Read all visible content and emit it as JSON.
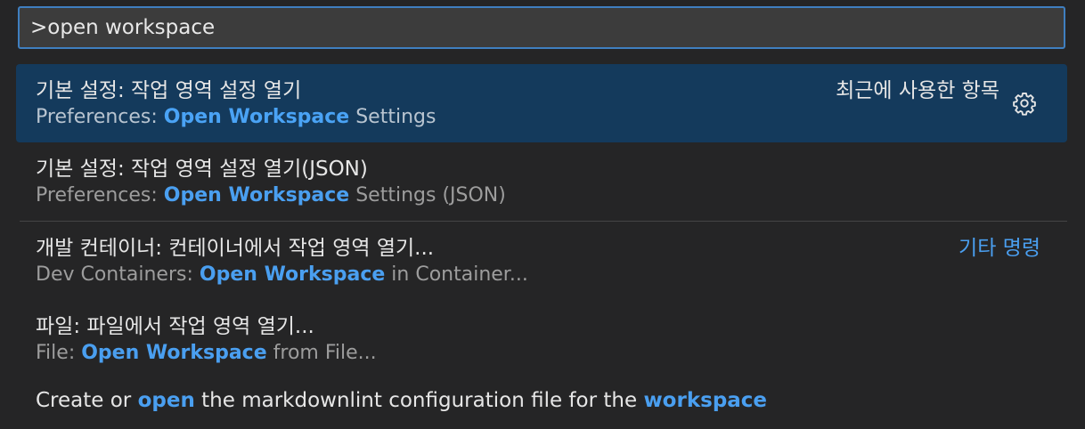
{
  "search": {
    "value": ">open workspace"
  },
  "items": [
    {
      "title": "기본 설정: 작업 영역 설정 열기",
      "subtitle_prefix": "Preferences: ",
      "subtitle_hl": "Open Workspace",
      "subtitle_suffix": " Settings",
      "right_label": "최근에 사용한 항목"
    },
    {
      "title": "기본 설정: 작업 영역 설정 열기(JSON)",
      "subtitle_prefix": "Preferences: ",
      "subtitle_hl": "Open Workspace",
      "subtitle_suffix": " Settings (JSON)"
    },
    {
      "title": "개발 컨테이너: 컨테이너에서 작업 영역 열기...",
      "subtitle_prefix": "Dev Containers: ",
      "subtitle_hl": "Open Workspace",
      "subtitle_suffix": " in Container...",
      "right_label": "기타 명령"
    },
    {
      "title": "파일: 파일에서 작업 영역 열기...",
      "subtitle_prefix": "File: ",
      "subtitle_hl": "Open Workspace",
      "subtitle_suffix": " from File..."
    },
    {
      "title_a": "Create or ",
      "title_hl1": "open",
      "title_b": " the markdownlint configuration file for the ",
      "title_hl2": "workspace"
    }
  ],
  "icons": {
    "gear": "gear-icon"
  },
  "colors": {
    "background": "#252526",
    "input_border": "#3f7fc0",
    "selected_bg": "#143a5c",
    "highlight": "#4a9ff0"
  }
}
